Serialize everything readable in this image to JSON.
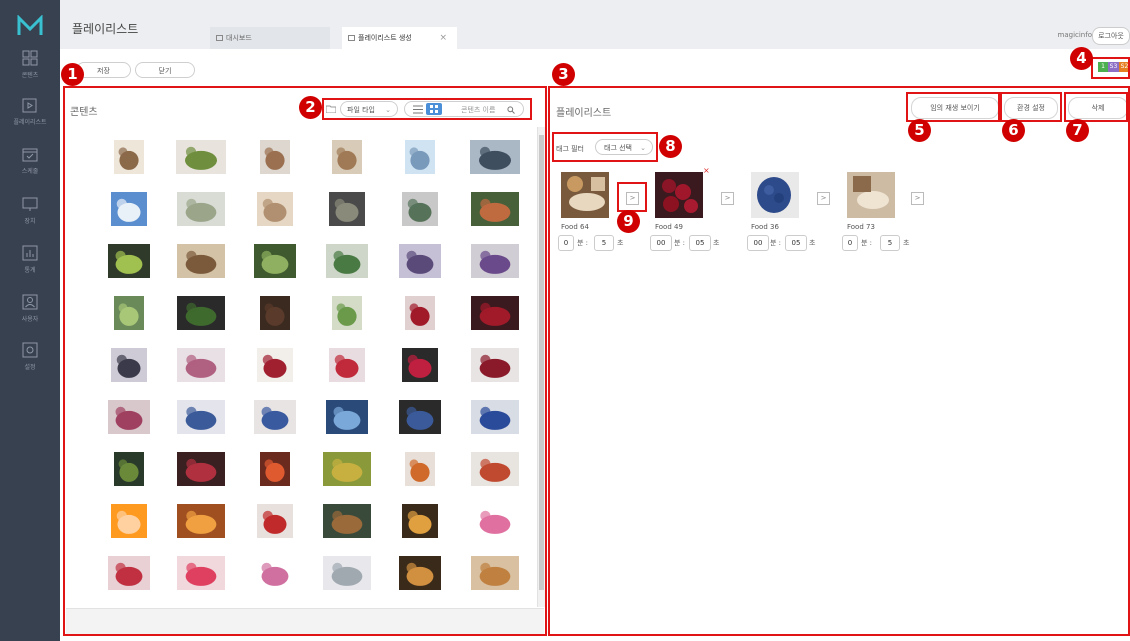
{
  "sidebar": {
    "items": [
      {
        "label": "콘텐츠",
        "icon": "content-grid-icon"
      },
      {
        "label": "플레이리스트",
        "icon": "playlist-icon"
      },
      {
        "label": "스케줄",
        "icon": "calendar-icon"
      },
      {
        "label": "장치",
        "icon": "monitor-icon"
      },
      {
        "label": "통계",
        "icon": "chart-icon"
      },
      {
        "label": "사용자",
        "icon": "user-icon"
      },
      {
        "label": "설정",
        "icon": "settings-icon"
      }
    ]
  },
  "header": {
    "title": "플레이리스트",
    "tabs": [
      {
        "label": "대시보드"
      },
      {
        "label": "플레이리스트 생성",
        "close": "×"
      }
    ],
    "user": "magicinfo",
    "logout": "로그아웃"
  },
  "toolbar": {
    "save": "저장",
    "close": "닫기"
  },
  "badges": {
    "items": [
      "1",
      "S3",
      "S2"
    ],
    "colors": [
      "#4caf50",
      "#8e6fc6",
      "#e67e22"
    ]
  },
  "content_panel": {
    "title": "콘텐츠",
    "file_type": "파일 타입",
    "search_placeholder": "콘텐츠 이름"
  },
  "playlist_panel": {
    "title": "플레이리스트",
    "buttons": {
      "random": "임의 재생 보이기",
      "settings": "환경 설정",
      "delete": "삭제"
    },
    "tag_filter_label": "태그 필터",
    "tag_select": "태그 선택",
    "items": [
      {
        "name": "Food 64",
        "min": "0",
        "sec": "5"
      },
      {
        "name": "Food 49",
        "min": "00",
        "sec": "05"
      },
      {
        "name": "Food 36",
        "min": "00",
        "sec": "05"
      },
      {
        "name": "Food 73",
        "min": "0",
        "sec": "5"
      }
    ],
    "min_unit": "분 :",
    "sec_unit": "초",
    "arrow": ">",
    "remove": "×"
  },
  "callouts": [
    "1",
    "2",
    "3",
    "4",
    "5",
    "6",
    "7",
    "8",
    "9"
  ],
  "colors": {
    "callout": "#d00000",
    "sidebar": "#38414f",
    "accent": "#4a8fd8"
  }
}
